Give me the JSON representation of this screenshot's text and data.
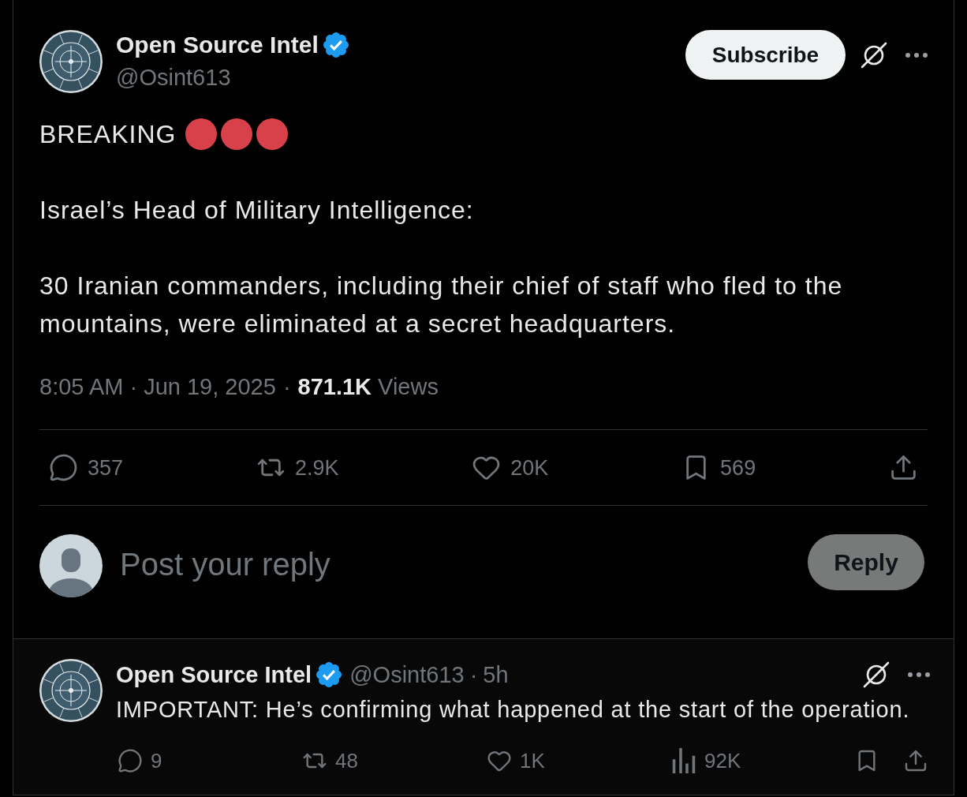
{
  "post": {
    "author": {
      "name": "Open Source Intel",
      "handle": "@Osint613",
      "verified": true
    },
    "subscribe_button": "Subscribe",
    "headline": "BREAKING",
    "paragraphs": [
      "Israel’s Head of Military Intelligence:",
      "30 Iranian commanders, including their chief of staff who fled to the mountains, were eliminated at a secret headquarters."
    ],
    "timestamp": "8:05 AM · Jun 19, 2025",
    "separator": "·",
    "views_count": "871.1K",
    "views_label": "Views",
    "actions": [
      {
        "kind": "reply",
        "count": "357"
      },
      {
        "kind": "repost",
        "count": "2.9K"
      },
      {
        "kind": "like",
        "count": "20K"
      },
      {
        "kind": "bookmark",
        "count": "569"
      },
      {
        "kind": "share"
      }
    ]
  },
  "reply_box": {
    "placeholder": "Post your reply",
    "button": {
      "label": "Reply",
      "disabled": true
    }
  },
  "reply_post": {
    "author": {
      "name": "Open Source Intel",
      "handle": "@Osint613",
      "verified": true
    },
    "separator": "·",
    "time": "5h",
    "text": "IMPORTANT: He’s confirming what happened at the start of the operation.",
    "actions": [
      {
        "kind": "reply",
        "count": "9"
      },
      {
        "kind": "repost",
        "count": "48"
      },
      {
        "kind": "like",
        "count": "1K"
      },
      {
        "kind": "views",
        "count": "92K"
      },
      {
        "kind": "bookmark"
      },
      {
        "kind": "share"
      }
    ]
  }
}
